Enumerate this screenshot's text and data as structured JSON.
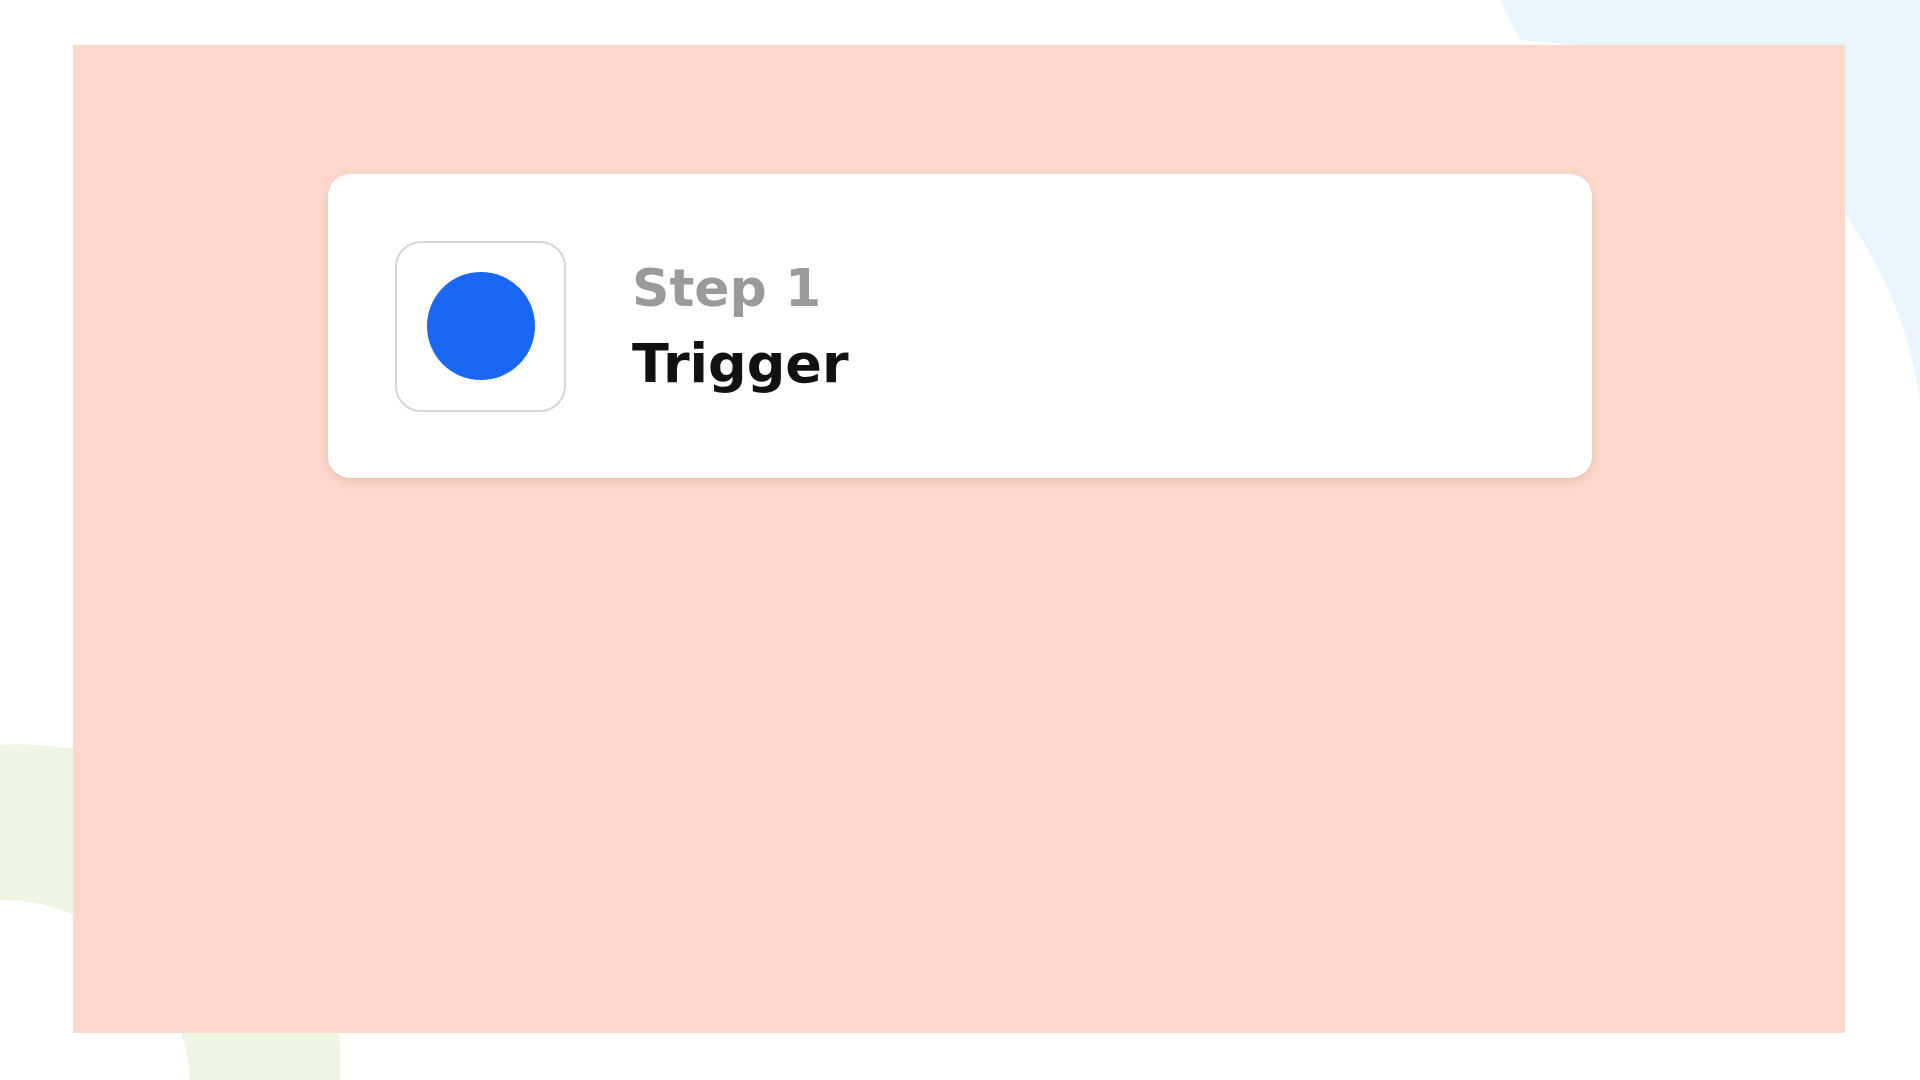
{
  "step": {
    "label": "Step 1",
    "title": "Trigger"
  }
}
